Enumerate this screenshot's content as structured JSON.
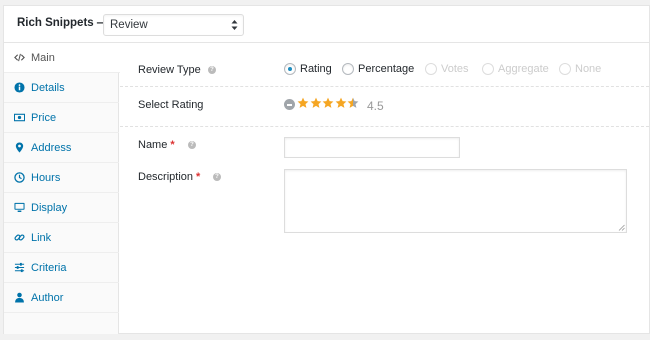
{
  "header": {
    "title": "Rich Snippets —",
    "select_value": "Review"
  },
  "sidebar": {
    "items": [
      {
        "label": "Main",
        "icon": "code-icon",
        "active": true
      },
      {
        "label": "Details",
        "icon": "info-icon"
      },
      {
        "label": "Price",
        "icon": "money-icon"
      },
      {
        "label": "Address",
        "icon": "map-marker-icon"
      },
      {
        "label": "Hours",
        "icon": "clock-icon"
      },
      {
        "label": "Display",
        "icon": "monitor-icon"
      },
      {
        "label": "Link",
        "icon": "link-icon"
      },
      {
        "label": "Criteria",
        "icon": "sliders-icon"
      },
      {
        "label": "Author",
        "icon": "user-icon"
      }
    ]
  },
  "form": {
    "review_type_label": "Review Type",
    "review_type_options": [
      {
        "label": "Rating",
        "selected": true,
        "disabled": false
      },
      {
        "label": "Percentage",
        "selected": false,
        "disabled": false
      },
      {
        "label": "Votes",
        "selected": false,
        "disabled": true
      },
      {
        "label": "Aggregate",
        "selected": false,
        "disabled": true
      },
      {
        "label": "None",
        "selected": false,
        "disabled": true
      }
    ],
    "select_rating_label": "Select Rating",
    "rating_value": "4.5",
    "rating_stars": 4.5,
    "rating_max": 5,
    "name_label": "Name",
    "name_value": "",
    "description_label": "Description",
    "description_value": "",
    "required_mark": "*",
    "help_glyph": "?"
  },
  "colors": {
    "link": "#0073aa",
    "star": "#f5a623",
    "required": "#dc3232",
    "radio_on": "#1e8cbe"
  }
}
